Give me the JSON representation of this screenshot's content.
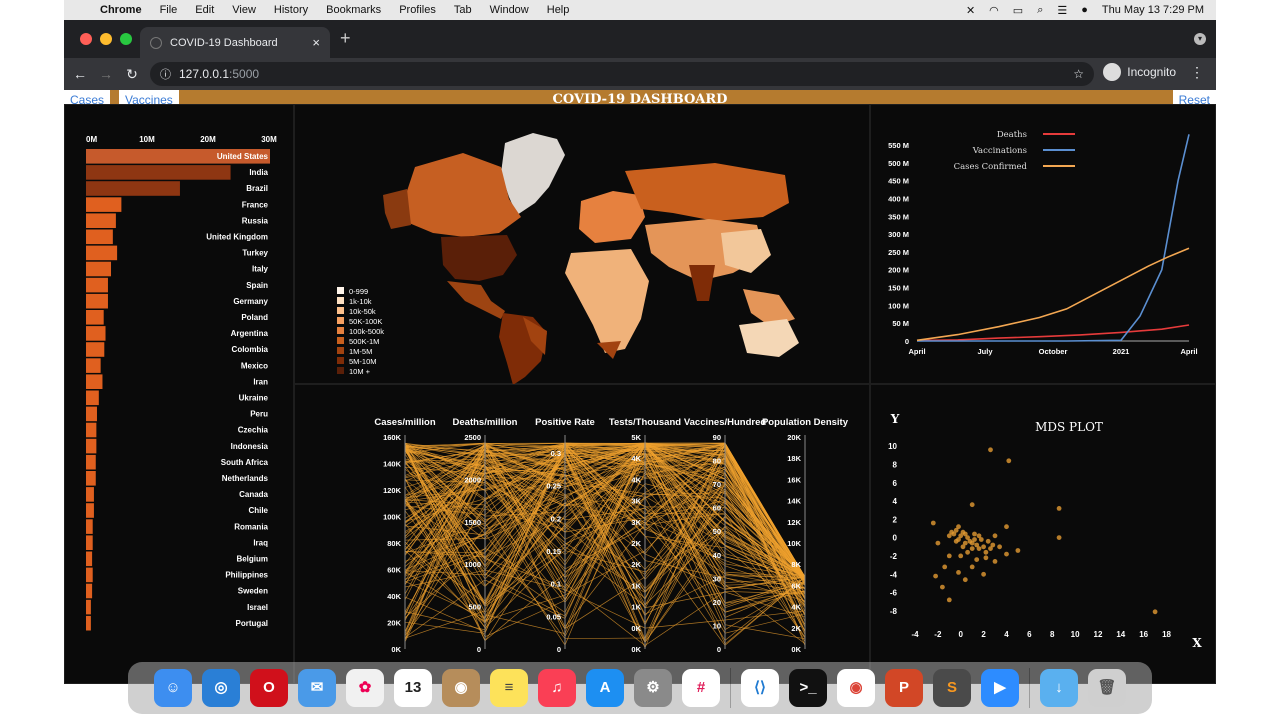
{
  "menubar": {
    "app": "Chrome",
    "items": [
      "File",
      "Edit",
      "View",
      "History",
      "Bookmarks",
      "Profiles",
      "Tab",
      "Window",
      "Help"
    ],
    "datetime": "Thu May 13  7:29 PM"
  },
  "browser": {
    "tab_title": "COVID-19 Dashboard",
    "url_host": "127.0.0.1",
    "url_port": ":5000",
    "profile": "Incognito"
  },
  "dashboard": {
    "title": "COVID-19 DASHBOARD",
    "btn_cases": "Cases",
    "btn_vaccines": "Vaccines",
    "btn_reset": "Reset"
  },
  "bar_chart": {
    "ticks": [
      "0M",
      "10M",
      "20M",
      "30M"
    ],
    "countries": [
      "United States",
      "India",
      "Brazil",
      "France",
      "Russia",
      "United Kingdom",
      "Turkey",
      "Italy",
      "Spain",
      "Germany",
      "Poland",
      "Argentina",
      "Colombia",
      "Mexico",
      "Iran",
      "Ukraine",
      "Peru",
      "Czechia",
      "Indonesia",
      "South Africa",
      "Netherlands",
      "Canada",
      "Chile",
      "Romania",
      "Iraq",
      "Belgium",
      "Philippines",
      "Sweden",
      "Israel",
      "Portugal"
    ],
    "values": [
      32.8,
      23.7,
      15.4,
      5.8,
      4.9,
      4.4,
      5.1,
      4.1,
      3.6,
      3.6,
      2.9,
      3.2,
      3.0,
      2.4,
      2.7,
      2.1,
      1.8,
      1.7,
      1.7,
      1.6,
      1.6,
      1.3,
      1.3,
      1.1,
      1.1,
      1.0,
      1.1,
      1.0,
      0.8,
      0.8
    ],
    "color_top": "#c65a2c",
    "color_rest": "#e0601f"
  },
  "map": {
    "legend": [
      "0-999",
      "1k-10k",
      "10k-50k",
      "50K-100K",
      "100k-500k",
      "500K-1M",
      "1M-5M",
      "5M-10M",
      "10M +"
    ],
    "legend_colors": [
      "#fff5eb",
      "#fde0c2",
      "#fdc08c",
      "#f7a162",
      "#e6813f",
      "#c9601e",
      "#a24310",
      "#7f2c07",
      "#5a1f08"
    ]
  },
  "line_chart": {
    "legend": [
      {
        "name": "Deaths",
        "color": "#e63b3b"
      },
      {
        "name": "Vaccinations",
        "color": "#5b8fd1"
      },
      {
        "name": "Cases Confirmed",
        "color": "#f3a752"
      }
    ],
    "yticks": [
      "0",
      "50 M",
      "100 M",
      "150 M",
      "200 M",
      "250 M",
      "300 M",
      "350 M",
      "400 M",
      "450 M",
      "500 M",
      "550 M"
    ],
    "xticks": [
      "April",
      "July",
      "October",
      "2021",
      "April"
    ],
    "ylim": [
      0,
      550
    ],
    "series": {
      "Deaths": [
        [
          0,
          1
        ],
        [
          0.15,
          3
        ],
        [
          0.3,
          8
        ],
        [
          0.45,
          12
        ],
        [
          0.6,
          17
        ],
        [
          0.75,
          24
        ],
        [
          0.9,
          33
        ],
        [
          1,
          45
        ]
      ],
      "Vaccinations": [
        [
          0,
          0
        ],
        [
          0.55,
          0
        ],
        [
          0.75,
          2
        ],
        [
          0.82,
          70
        ],
        [
          0.9,
          200
        ],
        [
          0.96,
          450
        ],
        [
          1,
          580
        ]
      ],
      "Cases Confirmed": [
        [
          0,
          2
        ],
        [
          0.15,
          18
        ],
        [
          0.3,
          40
        ],
        [
          0.45,
          66
        ],
        [
          0.55,
          90
        ],
        [
          0.65,
          130
        ],
        [
          0.75,
          170
        ],
        [
          0.85,
          210
        ],
        [
          0.92,
          235
        ],
        [
          1,
          260
        ]
      ]
    }
  },
  "parcoords": {
    "axes": [
      {
        "label": "Cases/million",
        "ticks": [
          "160K",
          "140K",
          "120K",
          "100K",
          "80K",
          "60K",
          "40K",
          "20K",
          "0K"
        ]
      },
      {
        "label": "Deaths/million",
        "ticks": [
          "2500",
          "2000",
          "1500",
          "1000",
          "500",
          "0"
        ]
      },
      {
        "label": "Positive Rate",
        "ticks": [
          "0.3",
          "0.25",
          "0.2",
          "0.15",
          "0.1",
          "0.05",
          "0"
        ]
      },
      {
        "label": "Tests/Thousand",
        "ticks": [
          "5K",
          "4K",
          "4K",
          "3K",
          "3K",
          "2K",
          "2K",
          "1K",
          "1K",
          "0K",
          "0K"
        ]
      },
      {
        "label": "Vaccines/Hundred",
        "ticks": [
          "90",
          "80",
          "70",
          "60",
          "50",
          "40",
          "30",
          "20",
          "10",
          "0"
        ]
      },
      {
        "label": "Population Density",
        "ticks": [
          "20K",
          "18K",
          "16K",
          "14K",
          "12K",
          "10K",
          "8K",
          "6K",
          "4K",
          "2K",
          "0K"
        ]
      }
    ],
    "line_color": "#f0a12e"
  },
  "mds": {
    "title": "MDS PLOT",
    "xlabel": "X",
    "ylabel": "Y",
    "xticks": [
      "-4",
      "-2",
      "0",
      "2",
      "4",
      "6",
      "8",
      "10",
      "12",
      "14",
      "16",
      "18"
    ],
    "yticks": [
      "10",
      "8",
      "6",
      "4",
      "2",
      "0",
      "-2",
      "-4",
      "-6",
      "-8"
    ],
    "xlim": [
      -4,
      19
    ],
    "ylim": [
      -9,
      11
    ],
    "point_color": "#e29a32",
    "points": [
      [
        2.6,
        9.6
      ],
      [
        4.2,
        8.4
      ],
      [
        1,
        3.6
      ],
      [
        8.6,
        3.2
      ],
      [
        4,
        1.2
      ],
      [
        8.6,
        0
      ],
      [
        -2.4,
        1.6
      ],
      [
        -2,
        -0.6
      ],
      [
        -1,
        -2
      ],
      [
        -1.4,
        -3.2
      ],
      [
        -2.2,
        -4.2
      ],
      [
        -1.6,
        -5.4
      ],
      [
        -1,
        -6.8
      ],
      [
        17,
        -8.1
      ],
      [
        5,
        -1.4
      ],
      [
        3.4,
        -1
      ],
      [
        4,
        -1.8
      ],
      [
        3,
        -2.6
      ],
      [
        2,
        -4
      ],
      [
        1,
        -3.2
      ],
      [
        0.4,
        -4.6
      ],
      [
        -0.2,
        -3.8
      ],
      [
        -0.8,
        0.6
      ],
      [
        -0.4,
        0.8
      ],
      [
        -0.2,
        1.2
      ],
      [
        -0.6,
        0.4
      ],
      [
        0,
        0.2
      ],
      [
        0.2,
        0.6
      ],
      [
        0.4,
        0.4
      ],
      [
        0.6,
        0
      ],
      [
        0.8,
        -0.4
      ],
      [
        1,
        -0.6
      ],
      [
        1.2,
        -0.2
      ],
      [
        1.4,
        -0.8
      ],
      [
        1.6,
        -1.2
      ],
      [
        2,
        -1
      ],
      [
        2.2,
        -1.6
      ],
      [
        2.4,
        -0.4
      ],
      [
        2.6,
        -1.2
      ],
      [
        0.2,
        -1
      ],
      [
        0.6,
        -1.6
      ],
      [
        1,
        -1.2
      ],
      [
        1.8,
        -0.2
      ],
      [
        -0.4,
        -0.4
      ],
      [
        -1,
        0.2
      ],
      [
        3,
        0.2
      ],
      [
        2.8,
        -0.8
      ],
      [
        0,
        -2
      ],
      [
        1.4,
        -2.4
      ],
      [
        2.2,
        -2.2
      ],
      [
        -0.2,
        -0.2
      ],
      [
        0.4,
        -0.6
      ],
      [
        1.2,
        0.4
      ],
      [
        1.6,
        0.2
      ]
    ]
  },
  "dock": [
    "Finder",
    "Safari",
    "Opera",
    "Mail",
    "Photos",
    "13",
    "Contacts",
    "Notes",
    "Music",
    "App Store",
    "Settings",
    "Slack",
    "VS Code",
    "Terminal",
    "Chrome",
    "PowerPoint",
    "Sublime",
    "Zoom",
    "Downloads",
    "Trash"
  ]
}
